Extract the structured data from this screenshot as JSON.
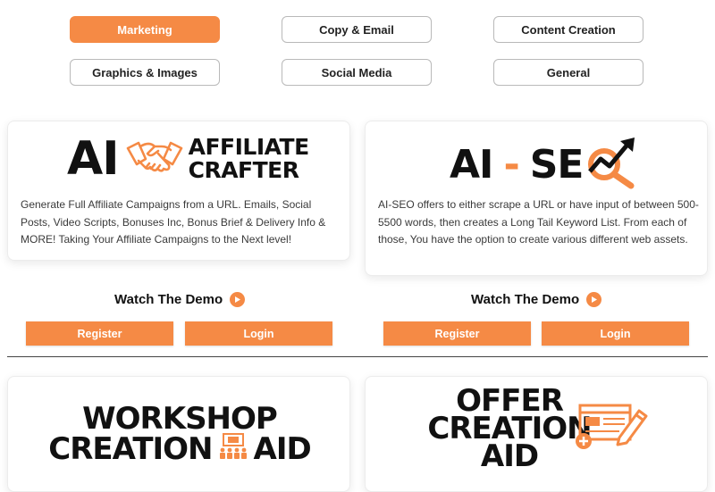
{
  "filters": {
    "marketing": "Marketing",
    "copy_email": "Copy & Email",
    "content_creation": "Content Creation",
    "graphics_images": "Graphics & Images",
    "social_media": "Social Media",
    "general": "General"
  },
  "colors": {
    "accent": "#f58a45",
    "text": "#111111"
  },
  "cards": {
    "affiliate": {
      "logo_ai": "AI",
      "logo_line1": "AFFILIATE",
      "logo_line2": "CRAFTER",
      "icon": "handshake-icon",
      "description": "Generate Full Affiliate Campaigns from a URL. Emails, Social Posts, Video Scripts, Bonuses Inc, Bonus Brief & Delivery Info & MORE! Taking Your Affiliate Campaigns to the Next level!",
      "watch": "Watch The Demo",
      "register": "Register",
      "login": "Login"
    },
    "seo": {
      "logo_ai": "AI",
      "logo_dash": "-",
      "logo_se": "SE",
      "icon": "magnifier-trend-icon",
      "description": "AI-SEO offers to either scrape a URL or have input of between 500-5500 words, then creates a Long Tail Keyword List. From each of those, You have the option to create various different web assets.",
      "watch": "Watch The Demo",
      "register": "Register",
      "login": "Login"
    },
    "workshop": {
      "line1": "WORKSHOP",
      "line2a": "CREATION",
      "line2b": "AID",
      "icon": "presentation-audience-icon"
    },
    "offer": {
      "line1": "OFFER",
      "line2": "CREATION",
      "line3": "AID",
      "icon": "browser-edit-icon"
    }
  }
}
